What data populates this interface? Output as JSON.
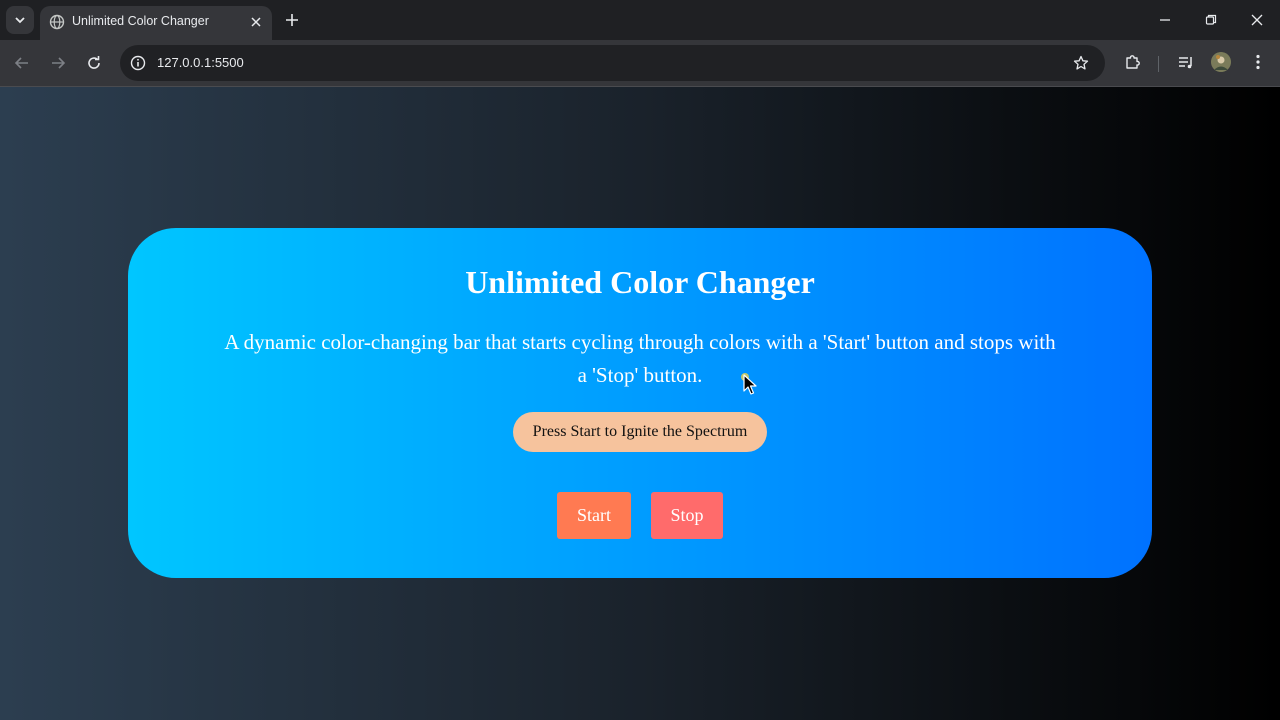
{
  "browser": {
    "tab_title": "Unlimited Color Changer",
    "url": "127.0.0.1:5500",
    "icons": {
      "tab_search": "chevron-down-icon",
      "favicon": "globe-icon",
      "tab_close": "close-icon",
      "new_tab": "plus-icon",
      "minimize": "minimize-icon",
      "restore": "restore-icon",
      "close_window": "close-icon",
      "back": "arrow-left-icon",
      "forward": "arrow-right-icon",
      "reload": "reload-icon",
      "site_info": "info-icon",
      "bookmark": "star-icon",
      "extensions": "puzzle-icon",
      "media": "media-queue-icon",
      "profile": "avatar",
      "menu": "kebab-menu-icon"
    }
  },
  "page": {
    "title": "Unlimited Color Changer",
    "description": "A dynamic color-changing bar that starts cycling through colors with a 'Start' button and stops with a 'Stop' button.",
    "status": "Press Start to Ignite the Spectrum",
    "start_label": "Start",
    "stop_label": "Stop"
  },
  "colors": {
    "background_gradient": [
      "#2c3e50",
      "#000000"
    ],
    "card_gradient": [
      "#00c6ff",
      "#0072ff"
    ],
    "status_pill": "#f6c39d",
    "start_button": "#ff7a52",
    "stop_button": "#ff6b6b"
  }
}
